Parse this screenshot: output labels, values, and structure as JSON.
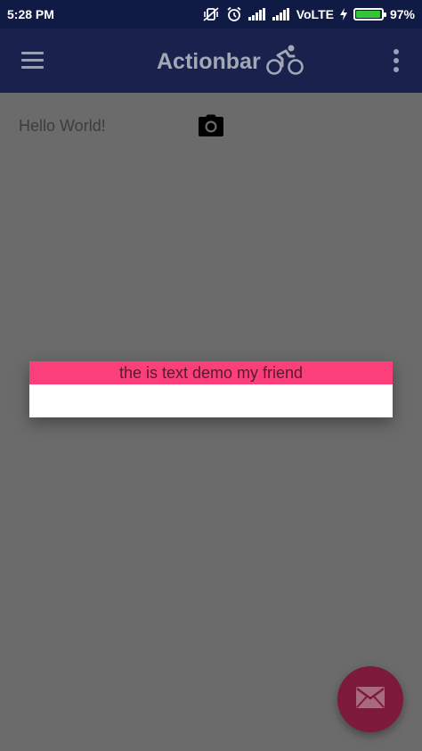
{
  "status_bar": {
    "time": "5:28 PM",
    "network": "VoLTE",
    "battery_percent": "97%",
    "battery_level": 0.97,
    "icons": [
      "mute-vibrate-icon",
      "alarm-icon",
      "signal-icon",
      "signal-icon",
      "charging-icon",
      "battery-icon"
    ]
  },
  "action_bar": {
    "title": "Actionbar",
    "icons": [
      "menu-icon",
      "bicycle-icon",
      "overflow-menu-icon"
    ]
  },
  "content": {
    "hello_text": "Hello World!",
    "camera_icon": "camera-icon"
  },
  "dialog": {
    "text": "the is text demo my friend"
  },
  "fab": {
    "icon": "mail-icon"
  },
  "colors": {
    "status_bar": "#0f1a45",
    "action_bar": "#18224d",
    "scrim": "#6b6b6b",
    "dialog_header": "#fb3f7a",
    "fab": "#7d1a3c"
  }
}
